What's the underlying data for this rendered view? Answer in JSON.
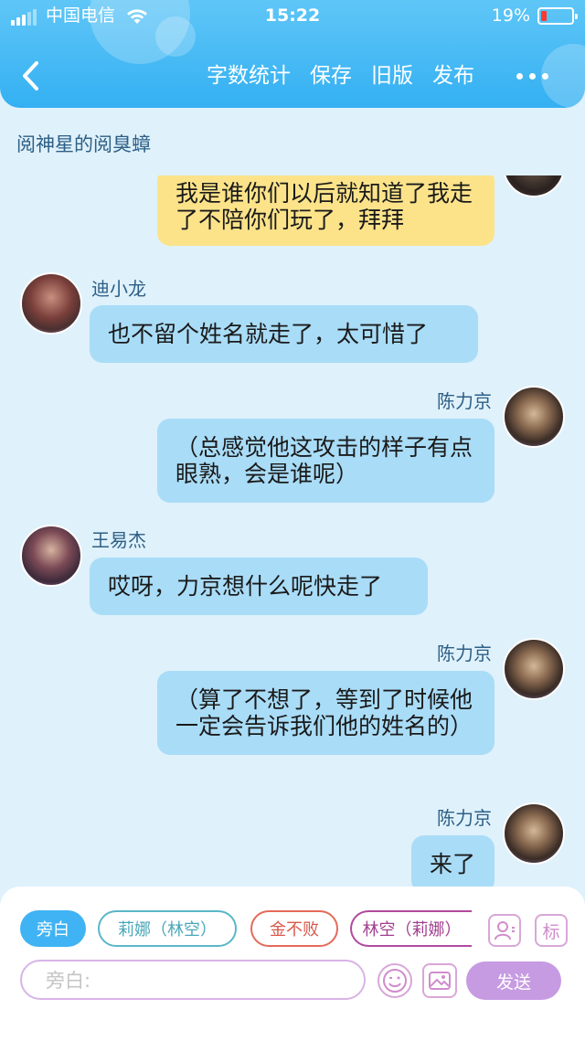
{
  "status_bar": {
    "carrier": "中国电信",
    "time": "15:22",
    "battery": "19%",
    "battery_level": 0.19
  },
  "nav": {
    "actions": [
      "字数统计",
      "保存",
      "旧版",
      "发布"
    ]
  },
  "story_title": "阅神星的阅臭蟑",
  "messages": [
    {
      "side": "right",
      "sender": "",
      "text": "我是谁你们以后就知道了我走了不陪你们玩了，拜拜",
      "color": "yellow"
    },
    {
      "side": "left",
      "sender": "迪小龙",
      "text": "也不留个姓名就走了，太可惜了",
      "color": "blue"
    },
    {
      "side": "right",
      "sender": "陈力京",
      "text": "（总感觉他这攻击的样子有点眼熟，会是谁呢）",
      "color": "blue"
    },
    {
      "side": "left",
      "sender": "王易杰",
      "text": "哎呀，力京想什么呢快走了",
      "color": "blue"
    },
    {
      "side": "right",
      "sender": "陈力京",
      "text": "（算了不想了，等到了时候他一定会告诉我们他的姓名的）",
      "color": "blue"
    },
    {
      "side": "right",
      "sender": "陈力京",
      "text": "来了",
      "color": "blue"
    }
  ],
  "composer": {
    "roles": [
      "旁白",
      "莉娜（林空）",
      "金不败",
      "林空（莉娜）"
    ],
    "mark_label": "标",
    "input_placeholder": "旁白:",
    "send_label": "发送"
  },
  "colors": {
    "header": "#34b0f2",
    "bubble_blue": "#a9dcf7",
    "bubble_yellow": "#fce38a",
    "send": "#c69be2",
    "chat_bg": "#dff1fb"
  }
}
